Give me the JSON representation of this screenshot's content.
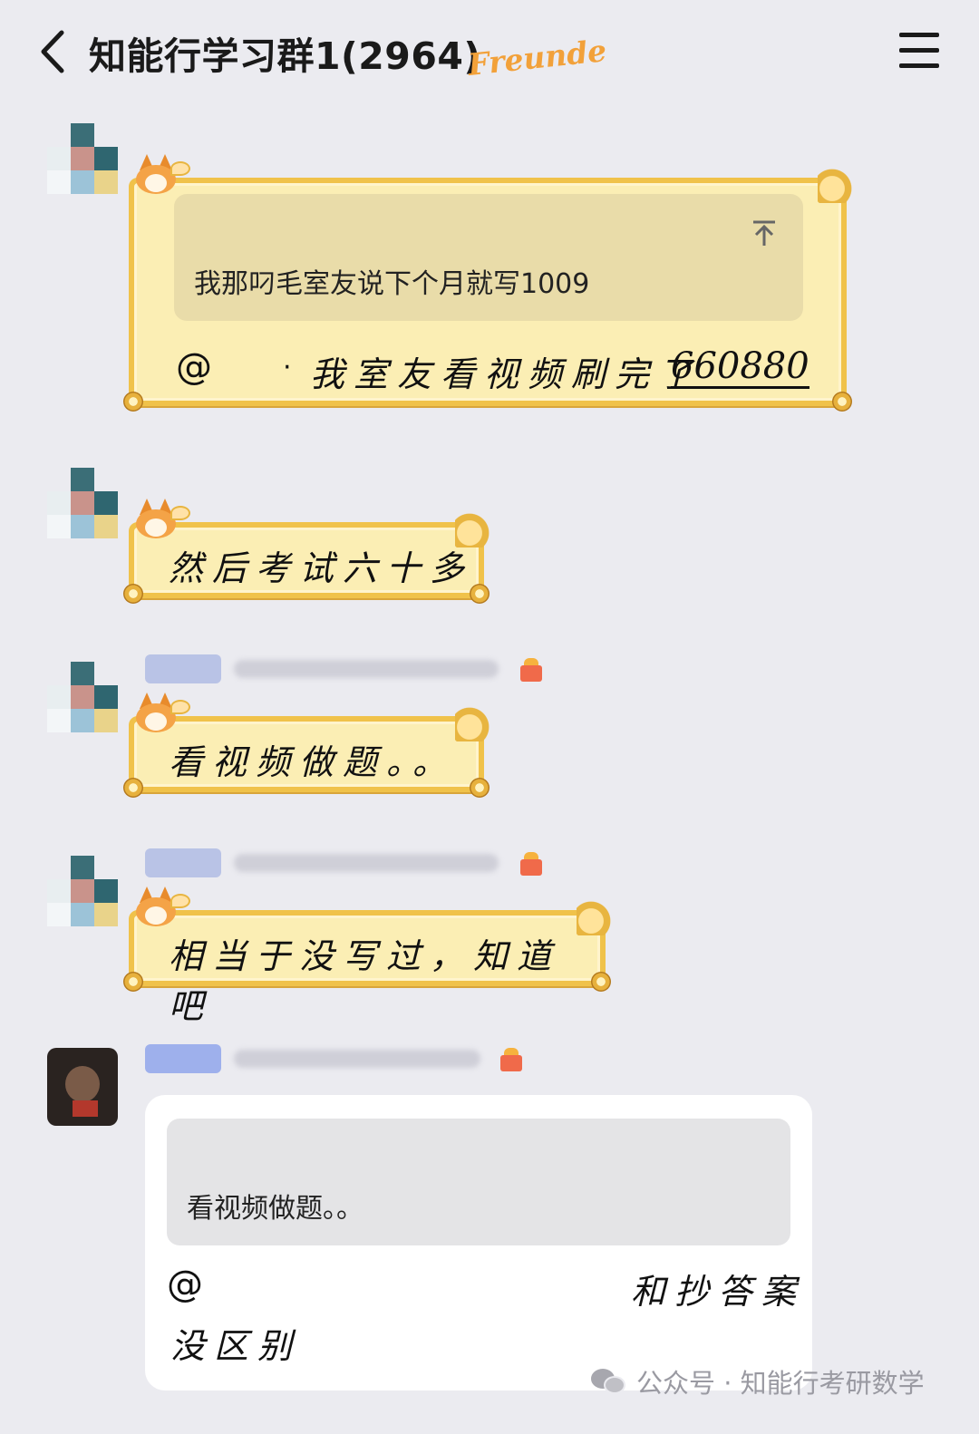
{
  "header": {
    "title": "知能行学习群1(2964)",
    "badge": "Freunde"
  },
  "messages": [
    {
      "quote": "我那叼毛室友说下个月就写1009",
      "at": "@",
      "dot": "·",
      "text": "我室友看视频刷完了",
      "number": "660880"
    },
    {
      "text": "然后考试六十多"
    },
    {
      "text": "看视频做题。。"
    },
    {
      "text": "相当于没写过，知道吧"
    },
    {
      "quote": "看视频做题。。",
      "at": "@",
      "text_right": "和抄答案",
      "text_line2": "没区别"
    }
  ],
  "watermark": {
    "text": "公众号 · 知能行考研数学"
  },
  "colors": {
    "background": "#ebebf0",
    "scroll_fill": "#fbeeb4",
    "scroll_border": "#f0c24a",
    "badge": "#f2a13a"
  }
}
